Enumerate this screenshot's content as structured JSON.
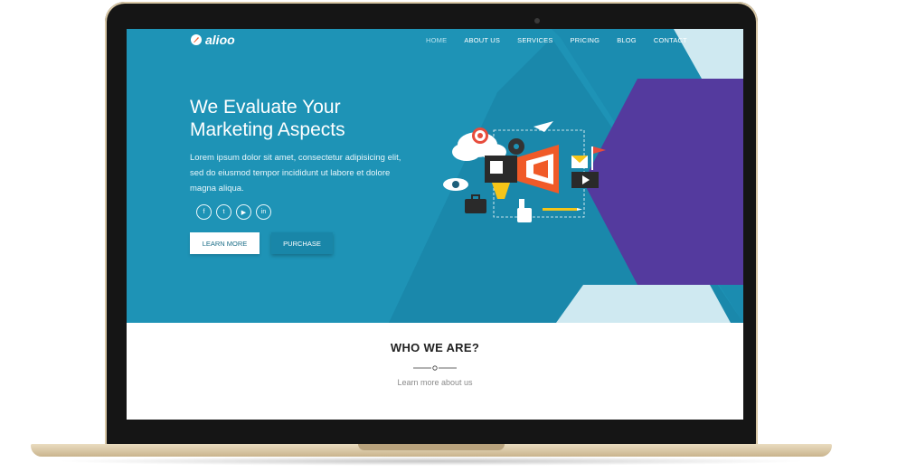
{
  "brand": {
    "logo_text": "alioo"
  },
  "nav": {
    "items": [
      {
        "label": "HOME",
        "active": true
      },
      {
        "label": "ABOUT US",
        "active": false
      },
      {
        "label": "SERVICES",
        "active": false
      },
      {
        "label": "PRICING",
        "active": false
      },
      {
        "label": "BLOG",
        "active": false
      },
      {
        "label": "CONTACT",
        "active": false
      }
    ]
  },
  "hero": {
    "title_line1": "We Evaluate Your",
    "title_line2": "Marketing Aspects",
    "description_line1": "Lorem ipsum dolor sit amet, consectetur adipisicing elit,",
    "description_line2": "sed do eiusmod tempor incididunt ut labore et dolore",
    "description_line3": "magna aliqua.",
    "socials": [
      {
        "icon": "facebook-icon",
        "glyph": "f"
      },
      {
        "icon": "twitter-icon",
        "glyph": "t"
      },
      {
        "icon": "youtube-icon",
        "glyph": "▶"
      },
      {
        "icon": "linkedin-icon",
        "glyph": "in"
      }
    ],
    "learn_more_label": "LEARN MORE",
    "purchase_label": "PURCHASE"
  },
  "about": {
    "title": "WHO WE ARE?",
    "subtitle": "Learn more about us"
  },
  "colors": {
    "hero_blue": "#1e93b6",
    "accent_purple": "#5b3a9c",
    "light_cyan": "#cfe9f1",
    "megaphone_orange": "#f05a28"
  }
}
